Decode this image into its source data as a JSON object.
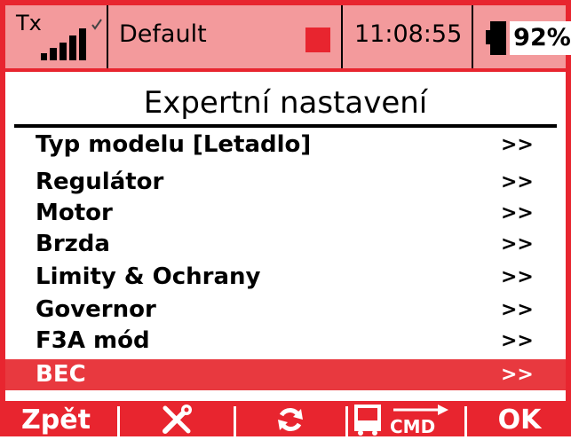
{
  "status_bar": {
    "tx_label": "Tx",
    "signal_icon": "signal-bars-icon",
    "profile_name": "Default",
    "record_icon": "record-indicator-icon",
    "time": "11:08:55",
    "battery_icon": "battery-icon",
    "battery_percent": "92%"
  },
  "title": "Expertní nastavení",
  "menu": {
    "items": [
      {
        "label": "Typ modelu [Letadlo]",
        "arrow": ">>",
        "selected": false
      },
      {
        "label": "Regulátor",
        "arrow": ">>",
        "selected": false
      },
      {
        "label": "Motor",
        "arrow": ">>",
        "selected": false
      },
      {
        "label": "Brzda",
        "arrow": ">>",
        "selected": false
      },
      {
        "label": "Limity & Ochrany",
        "arrow": ">>",
        "selected": false
      },
      {
        "label": "Governor",
        "arrow": ">>",
        "selected": false
      },
      {
        "label": "F3A mód",
        "arrow": ">>",
        "selected": false
      },
      {
        "label": "BEC",
        "arrow": ">>",
        "selected": true
      }
    ]
  },
  "softkeys": {
    "back": "Zpět",
    "tools_icon": "wrench-screwdriver-icon",
    "refresh_icon": "refresh-icon",
    "cmd_icon": "cmd-device-icon",
    "cmd_text": "CMD",
    "ok": "OK"
  },
  "colors": {
    "accent_red": "#e8252f",
    "status_pink": "#f39a9c",
    "selected_row": "#e8393f"
  }
}
